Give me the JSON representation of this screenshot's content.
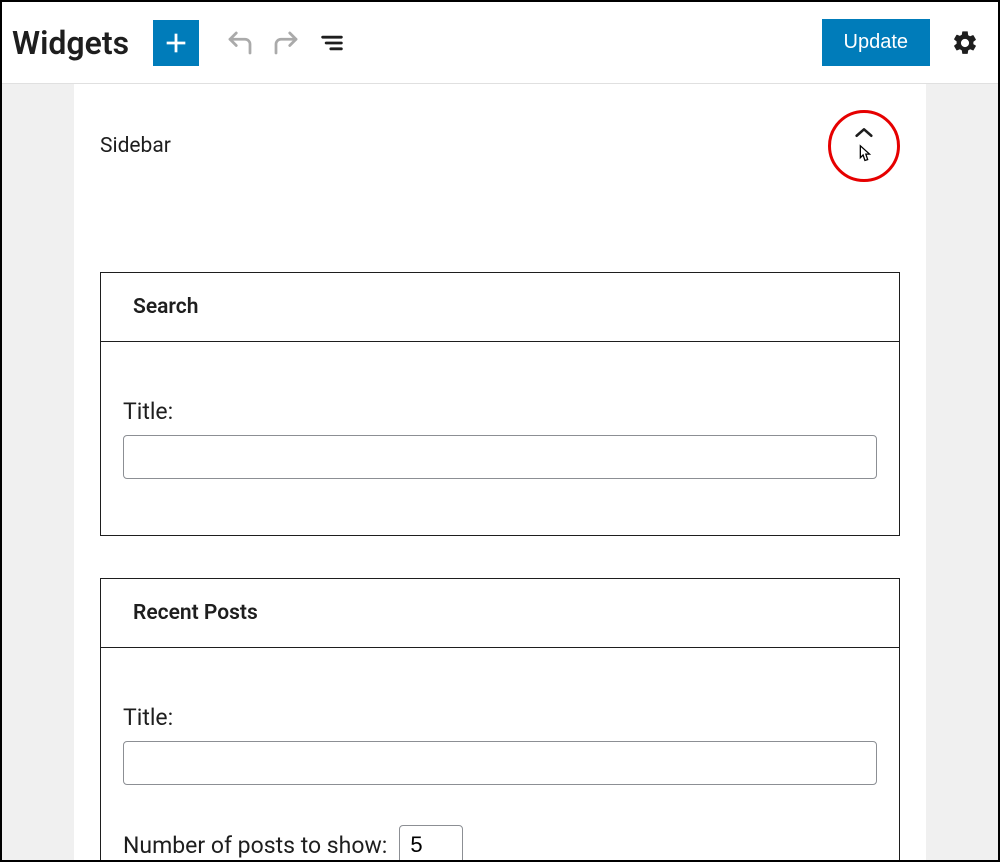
{
  "toolbar": {
    "page_title": "Widgets",
    "update_label": "Update"
  },
  "sidebar": {
    "title": "Sidebar"
  },
  "widgets": {
    "search": {
      "name": "Search",
      "title_label": "Title:",
      "title_value": ""
    },
    "recent_posts": {
      "name": "Recent Posts",
      "title_label": "Title:",
      "title_value": "",
      "num_posts_label": "Number of posts to show:",
      "num_posts_value": "5"
    }
  },
  "icons": {
    "add": "plus-icon",
    "undo": "undo-icon",
    "redo": "redo-icon",
    "outline": "outline-icon",
    "settings": "gear-icon",
    "collapse": "chevron-up-icon",
    "cursor": "pointer-cursor-icon"
  },
  "colors": {
    "primary": "#007cba",
    "highlight_ring": "#e60000"
  }
}
